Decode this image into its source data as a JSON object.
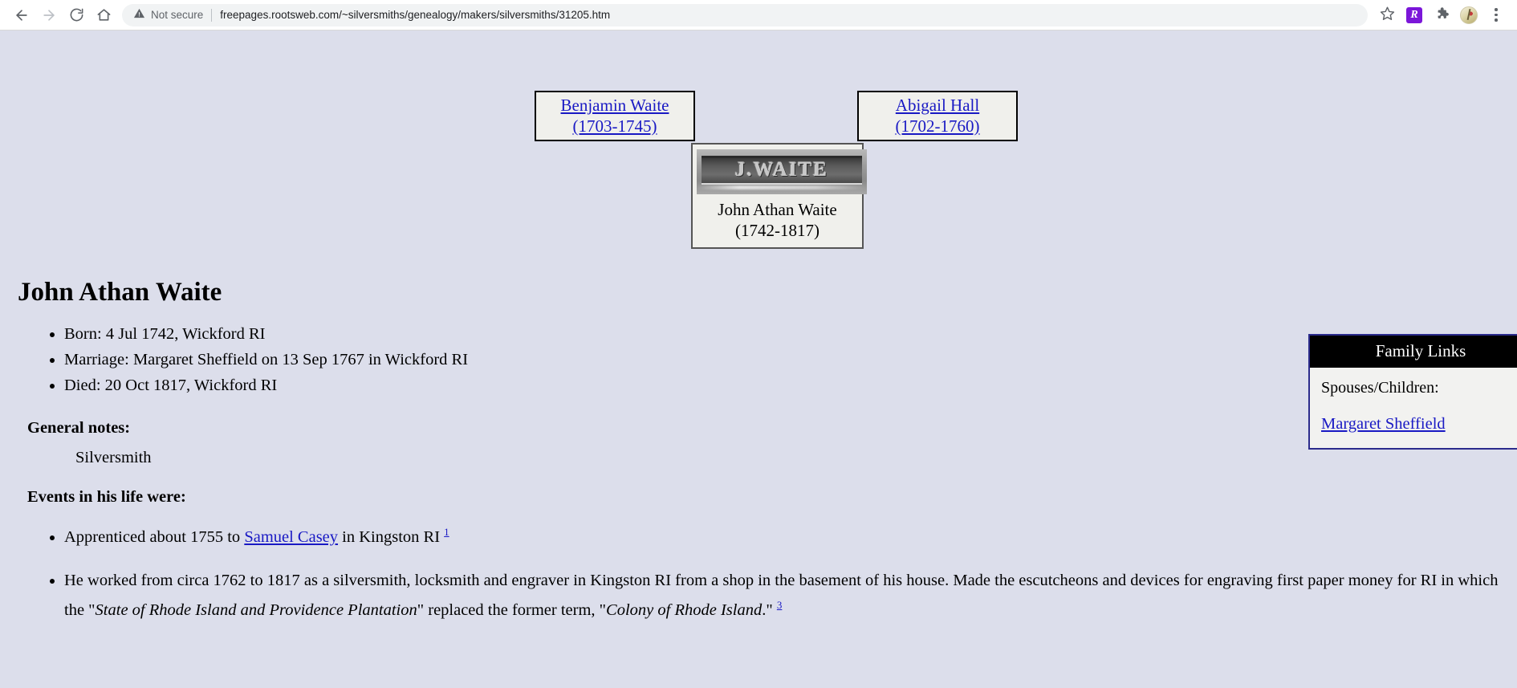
{
  "browser": {
    "back_icon": "back-arrow-icon",
    "forward_icon": "forward-arrow-icon",
    "reload_icon": "reload-icon",
    "home_icon": "home-icon",
    "security_label": "Not secure",
    "url": "freepages.rootsweb.com/~silversmiths/genealogy/makers/silversmiths/31205.htm",
    "bookmark_icon": "star-icon",
    "extension_label": "R",
    "extensions_icon": "puzzle-piece-icon",
    "profile_icon": "profile-avatar-icon",
    "menu_icon": "three-dot-menu-icon"
  },
  "tree": {
    "father": {
      "name": "Benjamin Waite",
      "years": "(1703-1745)"
    },
    "mother": {
      "name": "Abigail Hall",
      "years": "(1702-1760)"
    },
    "self": {
      "hallmark_text": "J.WAITE",
      "hallmark_alt": "silversmith-hallmark-image",
      "name": "John Athan Waite",
      "years": "(1742-1817)"
    }
  },
  "article": {
    "title": "John Athan Waite",
    "facts": [
      "Born: 4 Jul 1742, Wickford RI",
      "Marriage: Margaret Sheffield on 13 Sep 1767 in Wickford RI",
      "Died: 20 Oct 1817, Wickford RI"
    ],
    "notes_heading": "General notes:",
    "notes_body": "Silversmith",
    "events_heading": "Events in his life were:",
    "event1": {
      "pre": "Apprenticed about 1755 to ",
      "link": "Samuel Casey",
      "post": " in Kingston RI ",
      "footnote": "1"
    },
    "event2": {
      "part1": "He worked from circa 1762 to 1817 as a silversmith, locksmith and engraver in Kingston RI from a shop in the basement of his house. Made the escutcheons and devices for engraving first paper money for RI in which the \"",
      "italic1": "State of Rhode Island and Providence Plantation",
      "part2": "\" replaced the former term, \"",
      "italic2": "Colony of Rhode Island",
      "part3": ".\" ",
      "footnote": "3"
    }
  },
  "family_links": {
    "title": "Family Links",
    "label": "Spouses/Children:",
    "spouse": "Margaret Sheffield"
  },
  "colors": {
    "page_background": "#dcdeeb",
    "link": "#1919c4",
    "panel_border": "#2b2b8c",
    "panel_header": "#000000",
    "box_fill": "#f0f0ec"
  }
}
